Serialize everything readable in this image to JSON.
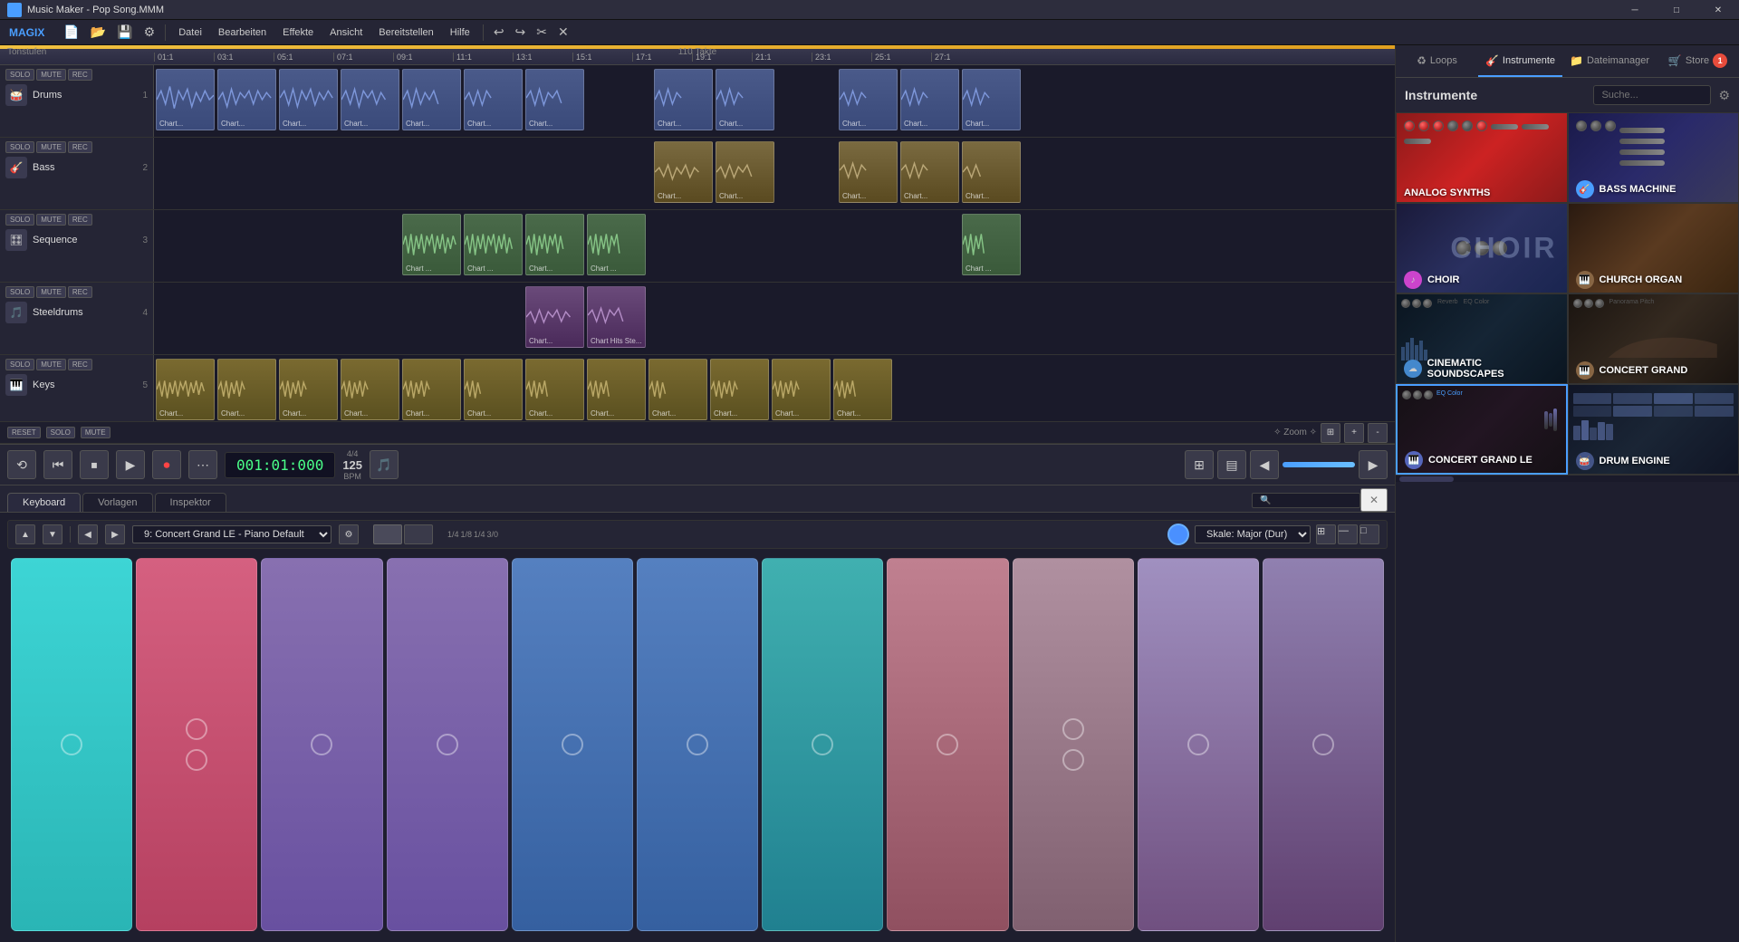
{
  "titlebar": {
    "title": "Music Maker - Pop Song.MMM",
    "app_name": "Music Maker",
    "file_name": "Pop Song.MMM",
    "controls": [
      "minimize",
      "maximize",
      "close"
    ]
  },
  "menubar": {
    "logo": "MAGIX",
    "items": [
      "Datei",
      "Bearbeiten",
      "Effekte",
      "Ansicht",
      "Bereitstellen",
      "Hilfe"
    ],
    "toolbar_buttons": [
      "new",
      "open",
      "save",
      "settings",
      "undo",
      "redo",
      "scissors",
      "close"
    ]
  },
  "tabs": {
    "right": [
      "Loops",
      "Instrumente",
      "Dateimanager",
      "Store"
    ]
  },
  "instruments_panel": {
    "title": "Instrumente",
    "search_placeholder": "Suche...",
    "cards": [
      {
        "id": "analog-synths",
        "name": "ANALOG SYNTHS",
        "bg": "red-gradient"
      },
      {
        "id": "bass-machine",
        "name": "BASS MACHINE",
        "bg": "blue-gradient"
      },
      {
        "id": "choir",
        "name": "CHOIR",
        "bg": "dark-blue-gradient"
      },
      {
        "id": "church-organ",
        "name": "CHURCH ORGAN",
        "bg": "brown-gradient"
      },
      {
        "id": "cinematic-soundscapes",
        "name": "CINEMATIC SOUNDSCAPES",
        "bg": "dark-gradient"
      },
      {
        "id": "concert-grand",
        "name": "CONCERT GRAND",
        "bg": "dark-brown-gradient"
      },
      {
        "id": "concert-grand-le",
        "name": "CONCERT GRAND LE",
        "bg": "dark-purple-gradient"
      },
      {
        "id": "drum-engine",
        "name": "DRUM ENGINE",
        "bg": "dark-blue2-gradient"
      }
    ]
  },
  "transport": {
    "time": "001:01:000",
    "time_sig": "4/4",
    "bpm": "125",
    "bpm_label": "BPM"
  },
  "tracks": [
    {
      "id": 1,
      "name": "Drums",
      "number": "1",
      "icon": "🥁"
    },
    {
      "id": 2,
      "name": "Bass",
      "number": "2",
      "icon": "🎸"
    },
    {
      "id": 3,
      "name": "Sequence",
      "number": "3",
      "icon": "🎹"
    },
    {
      "id": 4,
      "name": "Steeldrums",
      "number": "4",
      "icon": "🎵"
    },
    {
      "id": 5,
      "name": "Keys",
      "number": "5",
      "icon": "🎹"
    }
  ],
  "timeline": {
    "takt_count": "110 Takte",
    "markers": [
      "01:1",
      "03:1",
      "05:1",
      "07:1",
      "09:1",
      "11:1",
      "13:1",
      "15:1",
      "17:1",
      "19:1",
      "21:1",
      "23:1",
      "25:1",
      "27:1"
    ]
  },
  "bottom_panel": {
    "tabs": [
      "Keyboard",
      "Vorlagen",
      "Inspektor"
    ],
    "active_tab": "Keyboard",
    "preset": "9: Concert Grand LE - Piano Default",
    "scale": "Skale: Major (Dur)",
    "pads": [
      {
        "color": "cyan",
        "dots": 1
      },
      {
        "color": "pink",
        "dots": 2
      },
      {
        "color": "purple",
        "dots": 1
      },
      {
        "color": "purple",
        "dots": 1
      },
      {
        "color": "blue",
        "dots": 1
      },
      {
        "color": "blue",
        "dots": 1
      },
      {
        "color": "teal",
        "dots": 1
      },
      {
        "color": "mauve",
        "dots": 1
      },
      {
        "color": "mauve",
        "dots": 2
      },
      {
        "color": "mauve",
        "dots": 1
      },
      {
        "color": "purple2",
        "dots": 1
      }
    ]
  }
}
